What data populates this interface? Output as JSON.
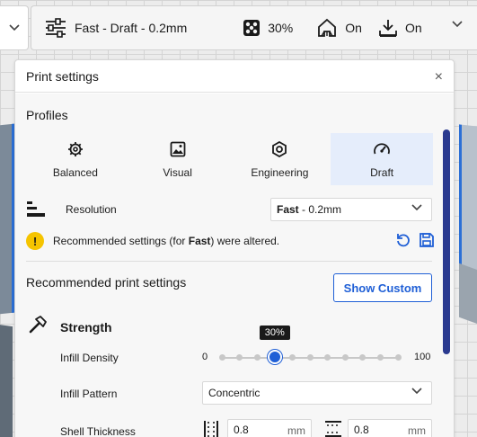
{
  "topbar": {
    "profile_label": "Fast - Draft - 0.2mm",
    "infill_value": "30%",
    "support_value": "On",
    "adhesion_value": "On"
  },
  "panel": {
    "title": "Print settings",
    "close_glyph": "×",
    "profiles": {
      "title": "Profiles",
      "tabs": [
        {
          "label": "Balanced",
          "icon": "gear-icon",
          "active": false
        },
        {
          "label": "Visual",
          "icon": "image-icon",
          "active": false
        },
        {
          "label": "Engineering",
          "icon": "hex-nut-icon",
          "active": false
        },
        {
          "label": "Draft",
          "icon": "gauge-icon",
          "active": true
        }
      ]
    },
    "resolution": {
      "label": "Resolution",
      "value_bold": "Fast",
      "value_rest": " - 0.2mm"
    },
    "warning": {
      "icon_glyph": "!",
      "text_before": "Recommended settings (for ",
      "text_bold": "Fast",
      "text_after": ") were altered."
    },
    "recommended": {
      "title": "Recommended print settings",
      "show_custom_label": "Show Custom"
    },
    "strength": {
      "title": "Strength",
      "infill_density_label": "Infill Density",
      "infill_min": "0",
      "infill_max": "100",
      "infill_value": 30,
      "infill_tooltip": "30%",
      "infill_pattern_label": "Infill Pattern",
      "infill_pattern_value": "Concentric",
      "shell_thickness_label": "Shell Thickness",
      "wall_value": "0.8",
      "top_bottom_value": "0.8",
      "unit": "mm"
    }
  },
  "colors": {
    "accent": "#1f5fd6",
    "warning": "#f5c400",
    "active_tab": "#e5edfb",
    "scrollbar": "#2a3a8f"
  }
}
